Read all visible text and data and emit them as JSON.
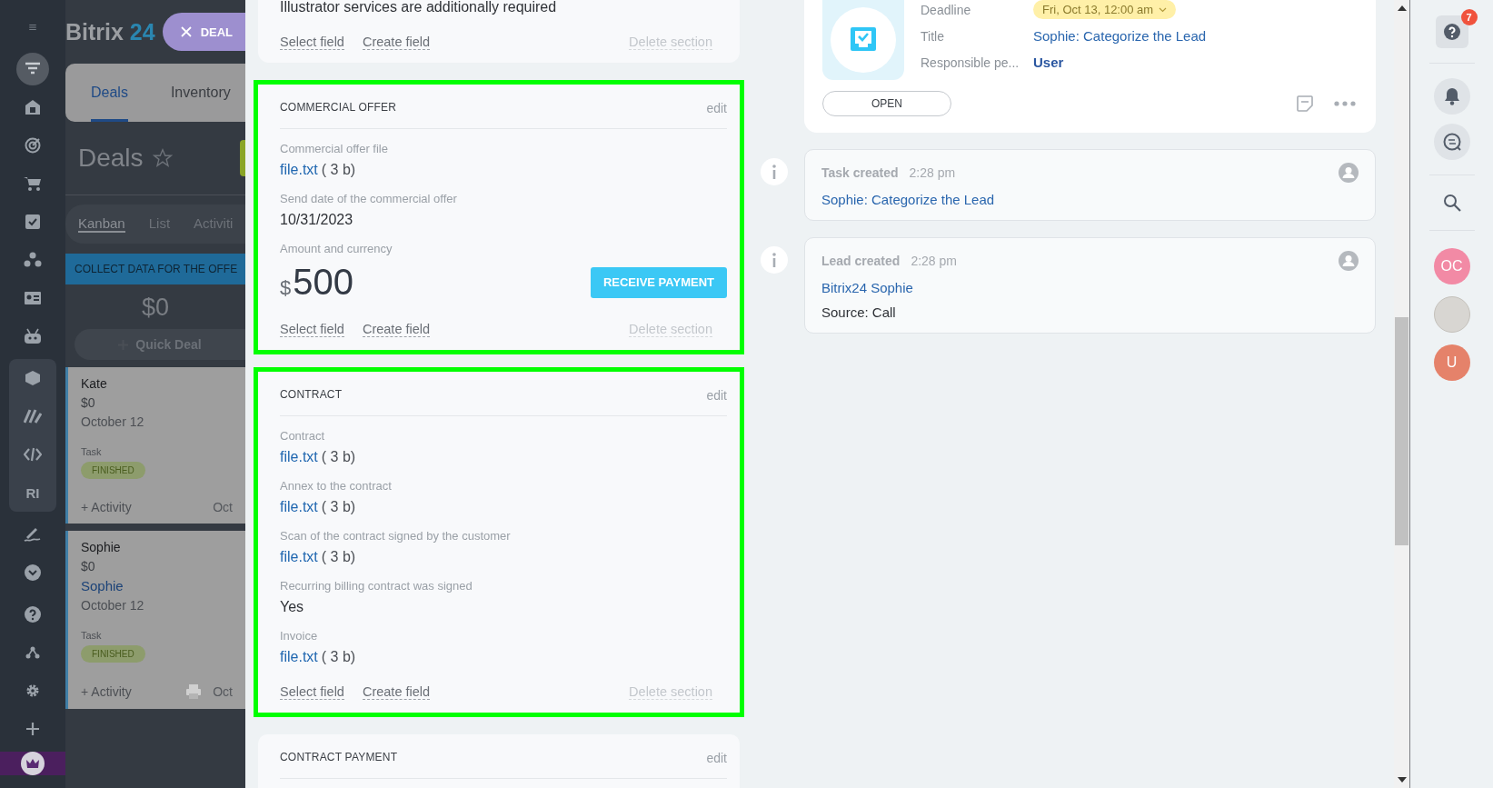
{
  "sidebar": {
    "sections": [
      {
        "kind": "plain",
        "items": [
          {
            "kind": "funnel",
            "selected": true
          },
          {
            "kind": "building",
            "selected": false
          },
          {
            "kind": "target",
            "selected": false
          },
          {
            "kind": "cart",
            "selected": false
          },
          {
            "kind": "task",
            "selected": false
          },
          {
            "kind": "share",
            "selected": false
          },
          {
            "kind": "contact",
            "selected": false
          },
          {
            "kind": "robot",
            "selected": false
          }
        ]
      },
      {
        "kind": "pinned",
        "items": [
          {
            "kind": "box",
            "selected": false
          },
          {
            "kind": "sign",
            "selected": false
          },
          {
            "kind": "code",
            "selected": false
          },
          {
            "kind": "text",
            "label": "RI",
            "selected": false
          }
        ]
      },
      {
        "kind": "plain",
        "items": [
          {
            "kind": "pen",
            "selected": false
          },
          {
            "kind": "chevron",
            "selected": false
          }
        ]
      },
      {
        "kind": "plain",
        "items": [
          {
            "kind": "help",
            "selected": false
          },
          {
            "kind": "tree",
            "selected": false
          },
          {
            "kind": "gear",
            "selected": false
          },
          {
            "kind": "plus",
            "selected": false
          }
        ]
      }
    ]
  },
  "logo": {
    "word": "Bitrix",
    "number": "24"
  },
  "deal_button": "DEAL",
  "kanban": {
    "tabs": [
      {
        "label": "Deals",
        "selected": true
      },
      {
        "label": "Inventory",
        "selected": false
      }
    ],
    "title": "Deals",
    "views": [
      {
        "label": "Kanban",
        "selected": true
      },
      {
        "label": "List",
        "selected": false
      },
      {
        "label": "Activiti",
        "selected": false
      }
    ],
    "column": {
      "title": "COLLECT DATA FOR THE OFFE",
      "total": "$0",
      "quick_add": "Quick Deal"
    },
    "cards": [
      {
        "name": "Kate",
        "amount": "$0",
        "date": "October 12",
        "task_label": "Task",
        "status": "FINISHED",
        "activity": "+ Activity",
        "date_short": "Oct",
        "print_icon": false
      },
      {
        "name": "Sophie",
        "amount": "$0",
        "contact": "Sophie",
        "date": "October 12",
        "task_label": "Task",
        "status": "FINISHED",
        "activity": "+ Activity",
        "date_short": "Oct",
        "print_icon": true
      }
    ]
  },
  "sections": [
    {
      "highlighted": false,
      "fields": [
        {
          "kind": "text",
          "value": "Illustrator services are additionally required"
        }
      ],
      "actions": {
        "select": "Select field",
        "create": "Create field",
        "delete": "Delete section"
      }
    },
    {
      "highlighted": true,
      "title": "COMMERCIAL OFFER",
      "edit": "edit",
      "fields": [
        {
          "kind": "file",
          "label": "Commercial offer file",
          "link": "file.txt",
          "size": "( 3 b)"
        },
        {
          "kind": "text",
          "label": "Send date of the commercial offer",
          "value": "10/31/2023"
        },
        {
          "kind": "money",
          "label": "Amount and currency",
          "currency": "$",
          "amount": "500",
          "button": "RECEIVE PAYMENT"
        }
      ],
      "actions": {
        "select": "Select field",
        "create": "Create field",
        "delete": "Delete section"
      }
    },
    {
      "highlighted": true,
      "title": "CONTRACT",
      "edit": "edit",
      "fields": [
        {
          "kind": "file",
          "label": "Contract",
          "link": "file.txt",
          "size": "( 3 b)"
        },
        {
          "kind": "file",
          "label": "Annex to the contract",
          "link": "file.txt",
          "size": "( 3 b)"
        },
        {
          "kind": "file",
          "label": "Scan of the contract signed by the customer",
          "link": "file.txt",
          "size": "( 3 b)"
        },
        {
          "kind": "text",
          "label": "Recurring billing contract was signed",
          "value": "Yes"
        },
        {
          "kind": "file",
          "label": "Invoice",
          "link": "file.txt",
          "size": "( 3 b)"
        }
      ],
      "actions": {
        "select": "Select field",
        "create": "Create field",
        "delete": "Delete section"
      }
    },
    {
      "highlighted": false,
      "title": "CONTRACT PAYMENT",
      "edit": "edit"
    }
  ],
  "activity": {
    "rows": [
      {
        "kind": "pill",
        "label": "Deadline",
        "value": "Fri, Oct 13, 12:00 am"
      },
      {
        "kind": "link",
        "label": "Title",
        "value": "Sophie: Categorize the Lead"
      },
      {
        "kind": "user",
        "label": "Responsible pe...",
        "value": "User"
      }
    ],
    "button": "OPEN"
  },
  "events": [
    {
      "title": "Task created",
      "time": "2:28 pm",
      "lines": [
        {
          "kind": "link",
          "text": "Sophie: Categorize the Lead"
        }
      ]
    },
    {
      "title": "Lead created",
      "time": "2:28 pm",
      "lines": [
        {
          "kind": "link",
          "text": "Bitrix24 Sophie"
        },
        {
          "kind": "text",
          "text": "Source: Call"
        }
      ]
    }
  ],
  "right_bar": {
    "help_badge": "7",
    "avatars": [
      {
        "kind": "initials",
        "text": "OC",
        "color": "#f28aa5"
      },
      {
        "kind": "photo"
      },
      {
        "kind": "initials",
        "text": "U",
        "color": "#e5826a"
      }
    ]
  }
}
